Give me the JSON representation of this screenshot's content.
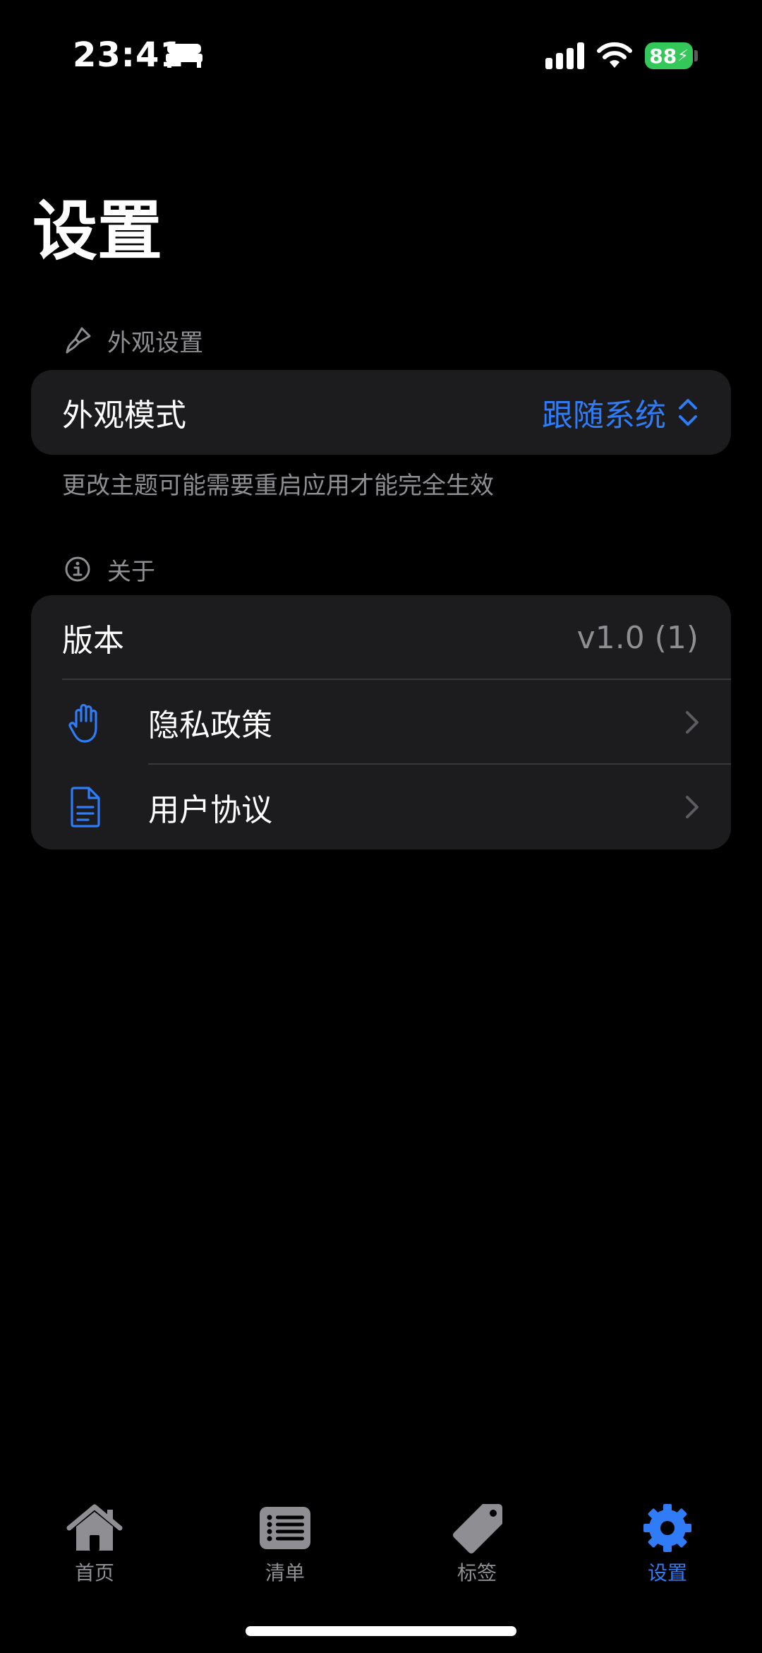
{
  "status_bar": {
    "time": "23:41",
    "battery_level": "88",
    "battery_color": "#34c759"
  },
  "title": "设置",
  "appearance_section": {
    "header": "外观设置",
    "header_icon": "paintbrush-icon",
    "row_label": "外观模式",
    "row_value": "跟随系统",
    "footnote": "更改主题可能需要重启应用才能完全生效"
  },
  "about_section": {
    "header": "关于",
    "header_icon": "info-circle-icon",
    "version_label": "版本",
    "version_value": "v1.0 (1)",
    "privacy_label": "隐私政策",
    "privacy_icon": "hand-raised-icon",
    "agreement_label": "用户协议",
    "agreement_icon": "document-icon"
  },
  "tab_bar": {
    "tabs": [
      {
        "label": "首页",
        "icon": "house-icon"
      },
      {
        "label": "清单",
        "icon": "list-icon"
      },
      {
        "label": "标签",
        "icon": "tag-icon"
      },
      {
        "label": "设置",
        "icon": "gear-icon"
      }
    ],
    "active_tab": "设置"
  },
  "colors": {
    "accent": "#2f7cf6",
    "background": "#000000",
    "card": "#1c1c1e",
    "secondary_text": "#8e8e93"
  }
}
